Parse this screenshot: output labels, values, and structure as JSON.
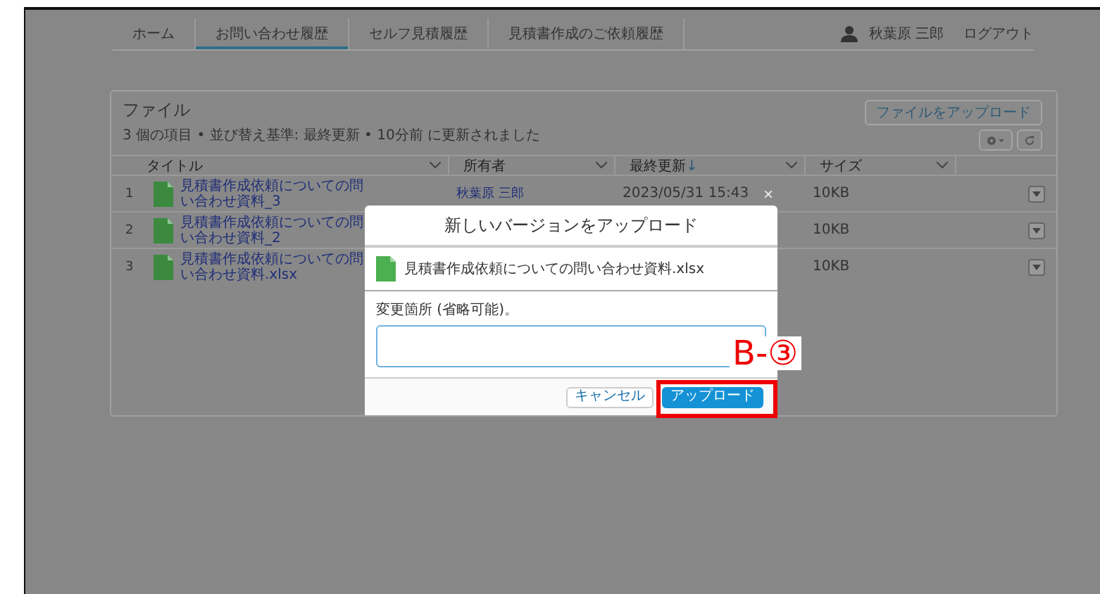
{
  "nav": {
    "tabs": [
      {
        "label": "ホーム",
        "selected": false
      },
      {
        "label": "お問い合わせ履歴",
        "selected": true
      },
      {
        "label": "セルフ見積履歴",
        "selected": false
      },
      {
        "label": "見積書作成のご依頼履歴",
        "selected": false
      }
    ],
    "user_name": "秋葉原 三郎",
    "logout": "ログアウト"
  },
  "files": {
    "title": "ファイル",
    "upload_button": "ファイルをアップロード",
    "status": "3 個の項目 • 並び替え基準: 最終更新 • 10分前 に更新されました",
    "columns": [
      {
        "label": "タイトル"
      },
      {
        "label": "所有者"
      },
      {
        "label": "最終更新",
        "sort_mark": "↓"
      },
      {
        "label": "サイズ"
      }
    ],
    "rows": [
      {
        "number": "1",
        "title": "見積書作成依頼についての問い合わせ資料_3",
        "owner": "秋葉原 三郎",
        "modified": "2023/05/31 15:43",
        "size": "10KB"
      },
      {
        "number": "2",
        "title": "見積書作成依頼についての問い合わせ資料_2",
        "size": "10KB"
      },
      {
        "number": "3",
        "title": "見積書作成依頼についての問い合わせ資料.xlsx",
        "size": "10KB"
      }
    ]
  },
  "modal": {
    "close": "×",
    "title": "新しいバージョンをアップロード",
    "file_name": "見積書作成依頼についての問い合わせ資料.xlsx",
    "field_label": "変更箇所 (省略可能)。",
    "cancel": "キャンセル",
    "upload": "アップロード"
  },
  "annotation": {
    "label": "B-③",
    "highlight": true
  }
}
